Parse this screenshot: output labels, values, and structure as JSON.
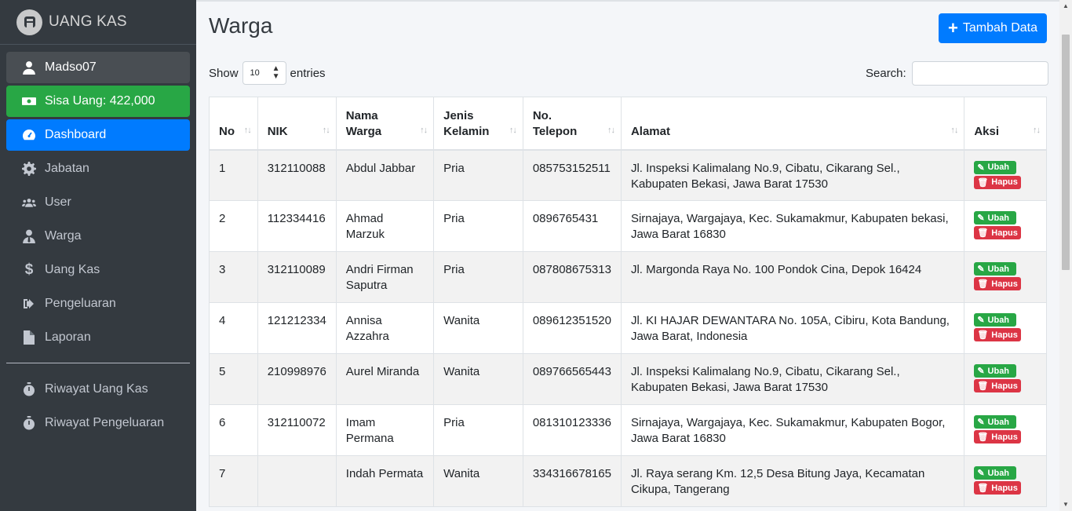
{
  "brand": {
    "name": "UANG KAS"
  },
  "sidebar": {
    "user": "Madso07",
    "balance": "Sisa Uang: 422,000",
    "items": [
      {
        "label": "Dashboard",
        "icon": "tachometer-icon"
      },
      {
        "label": "Jabatan",
        "icon": "gear-icon"
      },
      {
        "label": "User",
        "icon": "users-icon"
      },
      {
        "label": "Warga",
        "icon": "user-tie-icon"
      },
      {
        "label": "Uang Kas",
        "icon": "dollar-icon"
      },
      {
        "label": "Pengeluaran",
        "icon": "sign-out-icon"
      },
      {
        "label": "Laporan",
        "icon": "file-icon"
      }
    ],
    "history": [
      {
        "label": "Riwayat Uang Kas",
        "icon": "stopwatch-icon"
      },
      {
        "label": "Riwayat Pengeluaran",
        "icon": "stopwatch-icon"
      }
    ]
  },
  "header": {
    "title": "Warga",
    "add_button": "Tambah Data"
  },
  "controls": {
    "show_label": "Show",
    "entries_value": "10",
    "entries_label": "entries",
    "search_label": "Search:",
    "search_value": ""
  },
  "table": {
    "columns": [
      "No",
      "NIK",
      "Nama Warga",
      "Jenis Kelamin",
      "No. Telepon",
      "Alamat",
      "Aksi"
    ],
    "actions": {
      "edit": "Ubah",
      "delete": "Hapus"
    },
    "rows": [
      {
        "no": "1",
        "nik": "312110088",
        "nama": "Abdul Jabbar",
        "jk": "Pria",
        "telp": "085753152511",
        "alamat": "Jl. Inspeksi Kalimalang No.9, Cibatu, Cikarang Sel., Kabupaten Bekasi, Jawa Barat 17530"
      },
      {
        "no": "2",
        "nik": "112334416",
        "nama": "Ahmad Marzuk",
        "jk": "Pria",
        "telp": "0896765431",
        "alamat": "Sirnajaya, Wargajaya, Kec. Sukamakmur, Kabupaten bekasi, Jawa Barat 16830"
      },
      {
        "no": "3",
        "nik": "312110089",
        "nama": "Andri Firman Saputra",
        "jk": "Pria",
        "telp": "087808675313",
        "alamat": "Jl. Margonda Raya No. 100 Pondok Cina, Depok 16424"
      },
      {
        "no": "4",
        "nik": "121212334",
        "nama": "Annisa Azzahra",
        "jk": "Wanita",
        "telp": "089612351520",
        "alamat": "Jl. KI HAJAR DEWANTARA No. 105A, Cibiru, Kota Bandung, Jawa Barat, Indonesia"
      },
      {
        "no": "5",
        "nik": "210998976",
        "nama": "Aurel Miranda",
        "jk": "Wanita",
        "telp": "089766565443",
        "alamat": "Jl. Inspeksi Kalimalang No.9, Cibatu, Cikarang Sel., Kabupaten Bekasi, Jawa Barat 17530"
      },
      {
        "no": "6",
        "nik": "312110072",
        "nama": "Imam Permana",
        "jk": "Pria",
        "telp": "081310123336",
        "alamat": "Sirnajaya, Wargajaya, Kec. Sukamakmur, Kabupaten Bogor, Jawa Barat 16830"
      },
      {
        "no": "7",
        "nik": "",
        "nama": "Indah Permata",
        "jk": "Wanita",
        "telp": "334316678165",
        "alamat": "Jl. Raya serang Km. 12,5 Desa Bitung Jaya, Kecamatan Cikupa, Tangerang"
      }
    ]
  }
}
